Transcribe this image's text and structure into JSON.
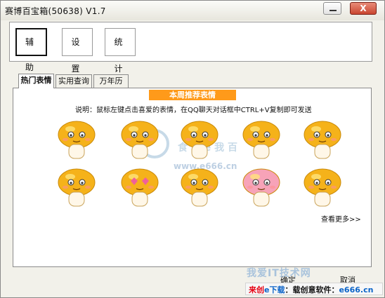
{
  "window": {
    "title": "赛博百宝箱(50638)  V1.7",
    "close_label": "X"
  },
  "toolbar": {
    "assist_label": "辅 助",
    "settings_label": "设 置",
    "stats_label": "统 计"
  },
  "tabs": [
    {
      "label": "热门表情"
    },
    {
      "label": "实用查询"
    },
    {
      "label": "万年历"
    }
  ],
  "content": {
    "banner": "本周推荐表情",
    "description": "说明：鼠标左键点击喜爱的表情，在QQ聊天对话框中CTRL+V复制即可发送",
    "more_link": "查看更多>>",
    "emoji_names": [
      "wave-sad-emoji-icon",
      "sleepy-emoji-icon",
      "shocked-emoji-icon",
      "dizzy-emoji-icon",
      "surprised-emoji-icon",
      "worried-emoji-icon",
      "love-eyes-emoji-icon",
      "teary-emoji-icon",
      "pink-shy-emoji-icon",
      "calm-emoji-icon"
    ]
  },
  "watermark": {
    "brand": "食 阝 e 我 百",
    "site": "www.e666.cn"
  },
  "bottom": {
    "ok_label": "确定",
    "cancel_label": "取消",
    "brand_watermark": "我爱IT技术网",
    "brand_bar_1": "来创",
    "brand_bar_2": "e下载",
    "brand_bar_3": "：载创意软件：",
    "brand_bar_4": "e666.cn"
  },
  "colors": {
    "banner_bg": "#ff9a1a",
    "window_bg": "#f2f1ea",
    "mushroom_cap": "#f5b21a",
    "close_button": "#c94630"
  }
}
